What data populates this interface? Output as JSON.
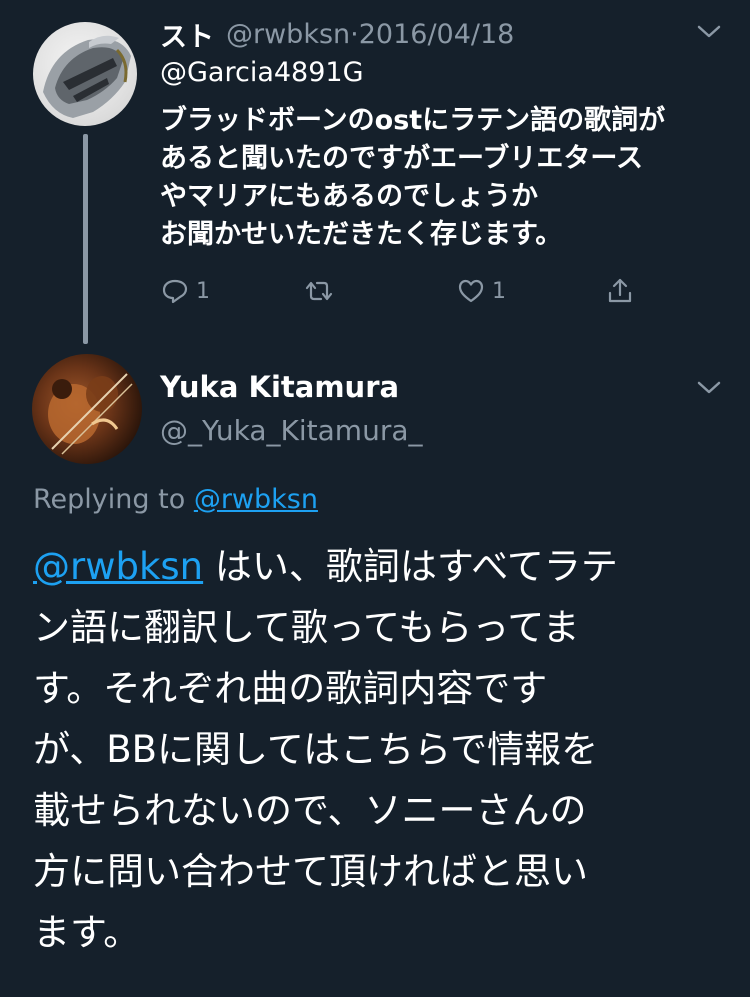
{
  "parent_tweet": {
    "display_name": "スト",
    "handle": "@rwbksn",
    "separator": "·",
    "date": "2016/04/18",
    "mention": "@Garcia4891G",
    "text_lines": [
      "ブラッドボーンのostにラテン語の歌詞が",
      "あると聞いたのですがエーブリエタース",
      "やマリアにもあるのでしょうか",
      "お聞かせいただきたく存じます。"
    ],
    "actions": {
      "reply_count": "1",
      "retweet_count": "",
      "like_count": "1"
    }
  },
  "reply_tweet": {
    "display_name": "Yuka Kitamura",
    "handle": "@_Yuka_Kitamura_",
    "replying_prefix": "Replying to",
    "replying_to": "@rwbksn",
    "mention": "@rwbksn",
    "first_line_rest": " はい、歌詞はすべてラテ",
    "text_lines": [
      "ン語に翻訳して歌ってもらってま",
      "す。それぞれ曲の歌詞内容です",
      "が、BBに関してはこちらで情報を",
      "載せられないので、ソニーさんの",
      "方に問い合わせて頂ければと思い",
      "ます。"
    ]
  },
  "colors": {
    "background": "#15202b",
    "secondary_text": "#8b98a5",
    "link": "#1da1f2"
  },
  "icons": {
    "menu": "chevron-down-icon",
    "reply": "reply-icon",
    "retweet": "retweet-icon",
    "like": "heart-icon",
    "share": "share-icon"
  }
}
